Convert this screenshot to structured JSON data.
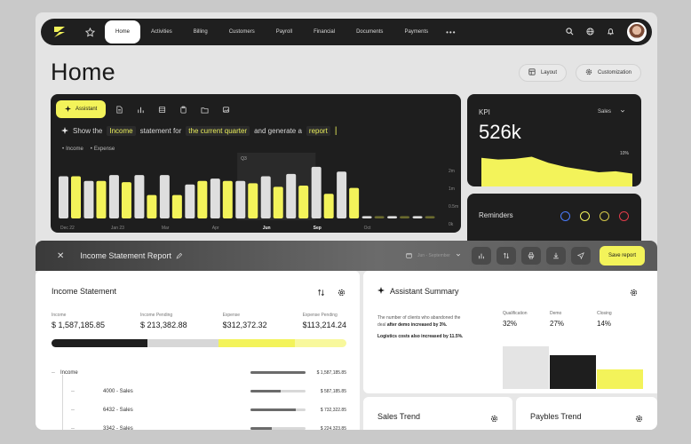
{
  "nav": {
    "items": [
      {
        "label": "Home",
        "active": true
      },
      {
        "label": "Activities"
      },
      {
        "label": "Billing"
      },
      {
        "label": "Customers"
      },
      {
        "label": "Payroll"
      },
      {
        "label": "Financial"
      },
      {
        "label": "Documents"
      },
      {
        "label": "Payments"
      }
    ],
    "more": "•••"
  },
  "page": {
    "title": "Home",
    "layout_label": "Layout",
    "customization_label": "Customization"
  },
  "assistant": {
    "pill_label": "Assistant",
    "prompt": {
      "p1": "Show the",
      "h1": "Income",
      "p2": "statement for",
      "h2": "the current quarter",
      "p3": "and generate a",
      "h3": "report"
    },
    "legend": [
      "Income",
      "Expense"
    ]
  },
  "chart_data": {
    "type": "bar",
    "categories": [
      "Dec 22",
      "",
      "Jan 23",
      "",
      "Mar",
      "",
      "Apr",
      "",
      "Jun",
      "",
      "Sep",
      "",
      "Oct",
      "",
      ""
    ],
    "series": [
      {
        "name": "Income",
        "values": [
          36,
          32,
          37,
          37,
          37,
          29,
          34,
          32,
          36,
          38,
          44,
          40,
          2,
          2,
          2
        ]
      },
      {
        "name": "Expense",
        "values": [
          36,
          32,
          31,
          20,
          20,
          32,
          32,
          30,
          27,
          28,
          21,
          26,
          2,
          2,
          2
        ]
      }
    ],
    "bold_ticks": [
      "Jun",
      "Sep"
    ],
    "highlight_label": "Q3",
    "y_ticks": [
      "2m",
      "1m",
      "0.5m",
      "0k"
    ],
    "ylim": [
      0,
      50
    ],
    "colors": {
      "income": "#dedede",
      "expense": "#f3f35a"
    }
  },
  "kpi": {
    "label": "KPI",
    "value": "526k",
    "select": "Sales",
    "pct": "10%",
    "trend": [
      0.15,
      0.2,
      0.18,
      0.12,
      0.3,
      0.42,
      0.5,
      0.58,
      0.55,
      0.62
    ],
    "fill_color": "#f3f35a"
  },
  "reminders": {
    "title": "Reminders",
    "dot_colors": [
      "#4a7cff",
      "#f3f35a",
      "#d5c84a",
      "#e23c4a"
    ]
  },
  "report": {
    "title": "Income Statement Report",
    "date_range": "Jun - September",
    "save_label": "Save report"
  },
  "income_statement": {
    "title": "Income Statement",
    "metrics": [
      {
        "label": "Income",
        "value": "$ 1,587,185.85"
      },
      {
        "label": "Income Pending",
        "value": "$ 213,382.88"
      },
      {
        "label": "Expense",
        "value": "$312,372.32"
      },
      {
        "label": "Expense Pending",
        "value": "$113,214.24"
      }
    ],
    "progress": [
      {
        "share": 0.325,
        "color": "#1e1e1e"
      },
      {
        "share": 0.24,
        "color": "#d7d7d7"
      },
      {
        "share": 0.26,
        "color": "#f3f35a"
      },
      {
        "share": 0.175,
        "color": "#f8f89c"
      }
    ],
    "rows": [
      {
        "name": "Income",
        "value": "$ 1,587,185.85",
        "fill": 1.0,
        "child": false
      },
      {
        "name": "4000 - Sales",
        "value": "$ 587,185.85",
        "fill": 0.55,
        "child": true
      },
      {
        "name": "6432 - Sales",
        "value": "$ 732,322.85",
        "fill": 0.82,
        "child": true
      },
      {
        "name": "3342 - Sales",
        "value": "$ 224,323.85",
        "fill": 0.38,
        "child": true
      }
    ]
  },
  "assistant_summary": {
    "title": "Assistant Summary",
    "text_a": "The number of clients who abandoned the deal",
    "text_b": "after demo increased by 3%.",
    "text_c": "Logistics costs also increased by 11.5%.",
    "funnel": [
      {
        "label": "Qualification",
        "value": "32%",
        "height": 0.55,
        "color": "#e4e4e4"
      },
      {
        "label": "Demo",
        "value": "27%",
        "height": 0.43,
        "color": "#1e1e1e"
      },
      {
        "label": "Closing",
        "value": "14%",
        "height": 0.25,
        "color": "#f3f35a"
      }
    ]
  },
  "trends": {
    "sales": "Sales Trend",
    "payables": "Paybles Trend"
  }
}
